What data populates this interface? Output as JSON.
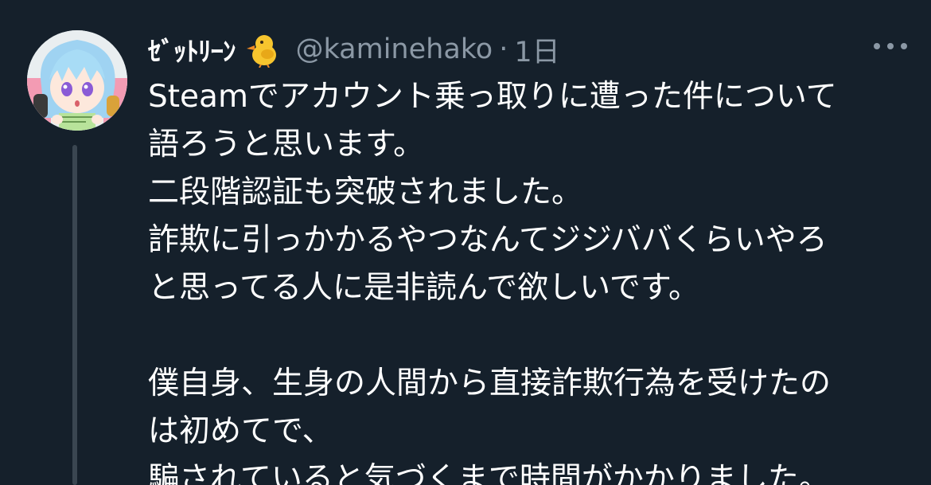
{
  "tweet": {
    "display_name": "ｾﾞｯﾄﾘｰﾝ",
    "emoji_icon": "baby-chick-emoji",
    "handle": "@kaminehako",
    "separator": "·",
    "time": "1日",
    "body_lines": [
      "Steamでアカウント乗っ取りに遭った件について",
      "語ろうと思います。",
      "二段階認証も突破されました。",
      "詐欺に引っかかるやつなんてジジババくらいやろ",
      "と思ってる人に是非読んで欲しいです。",
      "",
      "僕自身、生身の人間から直接詐欺行為を受けたの",
      "は初めてで、",
      "騙されていると気づくまで時間がかかりました。"
    ]
  },
  "colors": {
    "background": "#15202b",
    "text_primary": "#ffffff",
    "text_secondary": "#8b98a5",
    "thread_line": "#3a4651"
  }
}
